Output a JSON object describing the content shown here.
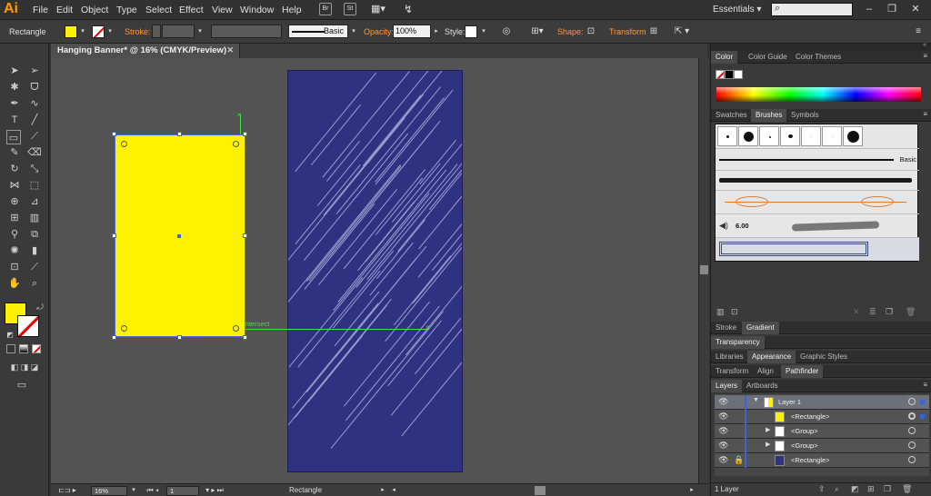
{
  "app": {
    "logo": "Ai"
  },
  "menu": [
    "File",
    "Edit",
    "Object",
    "Type",
    "Select",
    "Effect",
    "View",
    "Window",
    "Help"
  ],
  "menubar_icons": {
    "bridge": "Br",
    "stock": "St"
  },
  "workspace": "Essentials",
  "window_controls": [
    "–",
    "❐",
    "✕"
  ],
  "control_bar": {
    "selection": "Rectangle",
    "stroke_label": "Stroke:",
    "brush_value": "Basic",
    "opacity_label": "Opacity:",
    "opacity_value": "100%",
    "style_label": "Style:",
    "shape_label": "Shape:",
    "transform_label": "Transform",
    "fill_color": "#fff200"
  },
  "document": {
    "tab_title": "Hanging Banner* @ 16% (CMYK/Preview)",
    "close": "✕"
  },
  "canvas": {
    "artboard_color": "#2f3181",
    "rect_color": "#fff200",
    "guide_label": "intersect"
  },
  "bottom_bar": {
    "zoom": "16%",
    "artboard_number": "1",
    "status": "Rectangle"
  },
  "panels": {
    "color_tabs": [
      "Color",
      "Color Guide",
      "Color Themes"
    ],
    "brush_tabs": [
      "Swatches",
      "Brushes",
      "Symbols"
    ],
    "brush_basic_label": "Basic",
    "brush_size": "6.00",
    "stroke_tabs": [
      "Stroke",
      "Gradient"
    ],
    "transparency_tab": "Transparency",
    "appearance_tabs": [
      "Libraries",
      "Appearance",
      "Graphic Styles"
    ],
    "transform_tabs": [
      "Transform",
      "Align",
      "Pathfinder"
    ],
    "layers_tabs": [
      "Layers",
      "Artboards"
    ],
    "layers": [
      {
        "name": "Layer 1",
        "thumb": "#fff200"
      },
      {
        "name": "<Rectangle>",
        "thumb": "#fff200"
      },
      {
        "name": "<Group>",
        "thumb": "#ffffff"
      },
      {
        "name": "<Group>",
        "thumb": "#ffffff"
      },
      {
        "name": "<Rectangle>",
        "thumb": "#2f3181"
      }
    ],
    "layers_count": "1 Layer"
  }
}
